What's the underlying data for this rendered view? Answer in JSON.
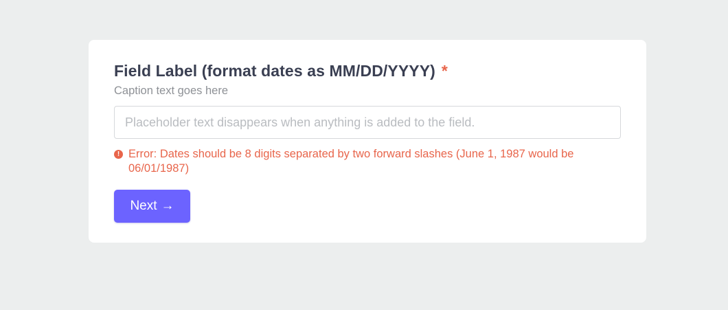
{
  "colors": {
    "background": "#eceeee",
    "card": "#ffffff",
    "accent": "#6c63ff",
    "error": "#e8654b",
    "label": "#3a3f52"
  },
  "form": {
    "label": "Field Label (format dates as MM/DD/YYYY)",
    "required_marker": "*",
    "caption": "Caption text goes here",
    "input": {
      "value": "",
      "placeholder": "Placeholder text disappears when anything is added to the field."
    },
    "error": {
      "icon": "alert-circle-icon",
      "icon_glyph": "!",
      "message": "Error: Dates should be 8 digits separated by two forward slashes (June 1, 1987 would be 06/01/1987)"
    },
    "next_button": {
      "label": "Next",
      "icon": "arrow-right-icon",
      "icon_glyph": "→"
    }
  }
}
